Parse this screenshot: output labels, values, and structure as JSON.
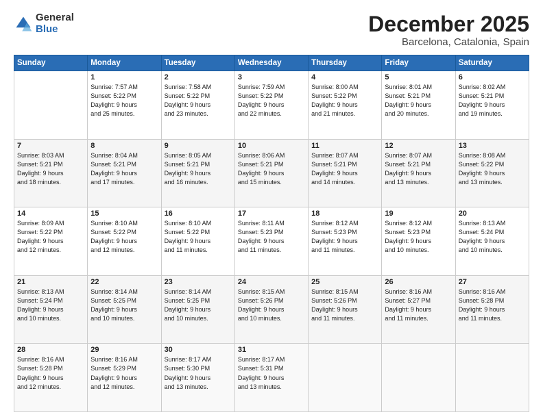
{
  "logo": {
    "general": "General",
    "blue": "Blue"
  },
  "title": "December 2025",
  "subtitle": "Barcelona, Catalonia, Spain",
  "days": [
    "Sunday",
    "Monday",
    "Tuesday",
    "Wednesday",
    "Thursday",
    "Friday",
    "Saturday"
  ],
  "weeks": [
    [
      {
        "day": "",
        "text": ""
      },
      {
        "day": "1",
        "text": "Sunrise: 7:57 AM\nSunset: 5:22 PM\nDaylight: 9 hours\nand 25 minutes."
      },
      {
        "day": "2",
        "text": "Sunrise: 7:58 AM\nSunset: 5:22 PM\nDaylight: 9 hours\nand 23 minutes."
      },
      {
        "day": "3",
        "text": "Sunrise: 7:59 AM\nSunset: 5:22 PM\nDaylight: 9 hours\nand 22 minutes."
      },
      {
        "day": "4",
        "text": "Sunrise: 8:00 AM\nSunset: 5:22 PM\nDaylight: 9 hours\nand 21 minutes."
      },
      {
        "day": "5",
        "text": "Sunrise: 8:01 AM\nSunset: 5:21 PM\nDaylight: 9 hours\nand 20 minutes."
      },
      {
        "day": "6",
        "text": "Sunrise: 8:02 AM\nSunset: 5:21 PM\nDaylight: 9 hours\nand 19 minutes."
      }
    ],
    [
      {
        "day": "7",
        "text": "Sunrise: 8:03 AM\nSunset: 5:21 PM\nDaylight: 9 hours\nand 18 minutes."
      },
      {
        "day": "8",
        "text": "Sunrise: 8:04 AM\nSunset: 5:21 PM\nDaylight: 9 hours\nand 17 minutes."
      },
      {
        "day": "9",
        "text": "Sunrise: 8:05 AM\nSunset: 5:21 PM\nDaylight: 9 hours\nand 16 minutes."
      },
      {
        "day": "10",
        "text": "Sunrise: 8:06 AM\nSunset: 5:21 PM\nDaylight: 9 hours\nand 15 minutes."
      },
      {
        "day": "11",
        "text": "Sunrise: 8:07 AM\nSunset: 5:21 PM\nDaylight: 9 hours\nand 14 minutes."
      },
      {
        "day": "12",
        "text": "Sunrise: 8:07 AM\nSunset: 5:21 PM\nDaylight: 9 hours\nand 13 minutes."
      },
      {
        "day": "13",
        "text": "Sunrise: 8:08 AM\nSunset: 5:22 PM\nDaylight: 9 hours\nand 13 minutes."
      }
    ],
    [
      {
        "day": "14",
        "text": "Sunrise: 8:09 AM\nSunset: 5:22 PM\nDaylight: 9 hours\nand 12 minutes."
      },
      {
        "day": "15",
        "text": "Sunrise: 8:10 AM\nSunset: 5:22 PM\nDaylight: 9 hours\nand 12 minutes."
      },
      {
        "day": "16",
        "text": "Sunrise: 8:10 AM\nSunset: 5:22 PM\nDaylight: 9 hours\nand 11 minutes."
      },
      {
        "day": "17",
        "text": "Sunrise: 8:11 AM\nSunset: 5:23 PM\nDaylight: 9 hours\nand 11 minutes."
      },
      {
        "day": "18",
        "text": "Sunrise: 8:12 AM\nSunset: 5:23 PM\nDaylight: 9 hours\nand 11 minutes."
      },
      {
        "day": "19",
        "text": "Sunrise: 8:12 AM\nSunset: 5:23 PM\nDaylight: 9 hours\nand 10 minutes."
      },
      {
        "day": "20",
        "text": "Sunrise: 8:13 AM\nSunset: 5:24 PM\nDaylight: 9 hours\nand 10 minutes."
      }
    ],
    [
      {
        "day": "21",
        "text": "Sunrise: 8:13 AM\nSunset: 5:24 PM\nDaylight: 9 hours\nand 10 minutes."
      },
      {
        "day": "22",
        "text": "Sunrise: 8:14 AM\nSunset: 5:25 PM\nDaylight: 9 hours\nand 10 minutes."
      },
      {
        "day": "23",
        "text": "Sunrise: 8:14 AM\nSunset: 5:25 PM\nDaylight: 9 hours\nand 10 minutes."
      },
      {
        "day": "24",
        "text": "Sunrise: 8:15 AM\nSunset: 5:26 PM\nDaylight: 9 hours\nand 10 minutes."
      },
      {
        "day": "25",
        "text": "Sunrise: 8:15 AM\nSunset: 5:26 PM\nDaylight: 9 hours\nand 11 minutes."
      },
      {
        "day": "26",
        "text": "Sunrise: 8:16 AM\nSunset: 5:27 PM\nDaylight: 9 hours\nand 11 minutes."
      },
      {
        "day": "27",
        "text": "Sunrise: 8:16 AM\nSunset: 5:28 PM\nDaylight: 9 hours\nand 11 minutes."
      }
    ],
    [
      {
        "day": "28",
        "text": "Sunrise: 8:16 AM\nSunset: 5:28 PM\nDaylight: 9 hours\nand 12 minutes."
      },
      {
        "day": "29",
        "text": "Sunrise: 8:16 AM\nSunset: 5:29 PM\nDaylight: 9 hours\nand 12 minutes."
      },
      {
        "day": "30",
        "text": "Sunrise: 8:17 AM\nSunset: 5:30 PM\nDaylight: 9 hours\nand 13 minutes."
      },
      {
        "day": "31",
        "text": "Sunrise: 8:17 AM\nSunset: 5:31 PM\nDaylight: 9 hours\nand 13 minutes."
      },
      {
        "day": "",
        "text": ""
      },
      {
        "day": "",
        "text": ""
      },
      {
        "day": "",
        "text": ""
      }
    ]
  ]
}
